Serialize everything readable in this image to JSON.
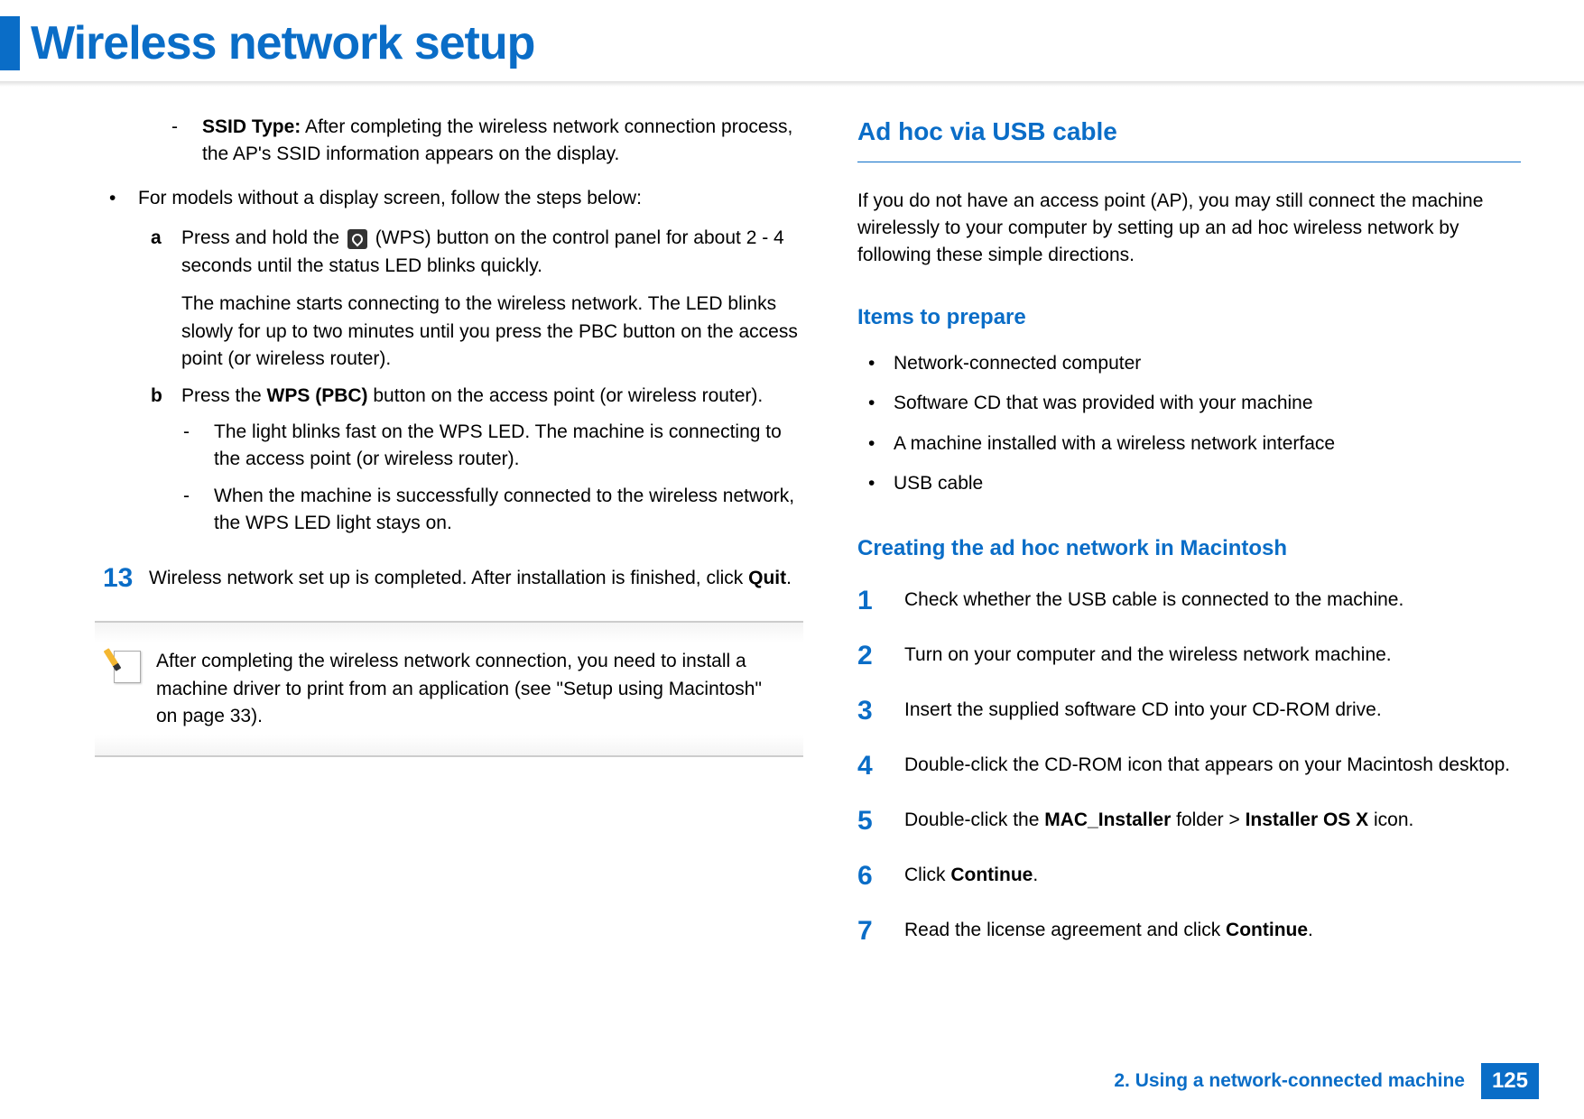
{
  "page_title": "Wireless network setup",
  "left": {
    "ssid_dash": {
      "label": "SSID Type:",
      "text": " After completing the wireless network connection process, the AP's SSID information appears on the display."
    },
    "no_display_bullet": "For models without a display screen, follow the steps below:",
    "step_a_pre": "Press and hold the ",
    "step_a_post": " (WPS) button on the control panel for about 2 - 4 seconds until the status LED blinks quickly.",
    "step_a_para2": "The machine starts connecting to the wireless network. The LED blinks slowly for up to two minutes until you press the PBC button on the access point (or wireless router).",
    "step_b_pre": "Press the ",
    "step_b_bold": "WPS (PBC)",
    "step_b_post": " button on the access point (or wireless router).",
    "b_dash1": "The light blinks fast on the WPS LED. The machine is connecting to the access point (or wireless router).",
    "b_dash2": "When the machine is successfully connected to the wireless network, the WPS LED light stays on.",
    "step13_num": "13",
    "step13_pre": "Wireless network set up is completed. After installation is finished, click ",
    "step13_bold": "Quit",
    "step13_post": ".",
    "note": "After completing the wireless network connection, you need to install a machine driver to print from an application (see \"Setup using Macintosh\" on page 33)."
  },
  "right": {
    "heading_adhoc": "Ad hoc via USB cable",
    "adhoc_intro": "If you do not have an access point (AP), you may still connect the machine wirelessly to your computer by setting up an ad hoc wireless network by following these simple directions.",
    "heading_items": "Items to prepare",
    "items": [
      "Network-connected computer",
      "Software CD that was provided with your machine",
      "A machine installed with a wireless network interface",
      "USB cable"
    ],
    "heading_create": "Creating the ad hoc network in Macintosh",
    "steps": [
      {
        "n": "1",
        "t": "Check whether the USB cable is connected to the machine."
      },
      {
        "n": "2",
        "t": "Turn on your computer and the wireless network machine."
      },
      {
        "n": "3",
        "t": "Insert the supplied software CD into your CD-ROM drive."
      },
      {
        "n": "4",
        "t": "Double-click the CD-ROM icon that appears on your Macintosh desktop."
      },
      {
        "n": "5",
        "pre": "Double-click the ",
        "b1": "MAC_Installer",
        "mid": " folder > ",
        "b2": "Installer OS X",
        "post": " icon."
      },
      {
        "n": "6",
        "pre": "Click ",
        "b1": "Continue",
        "post": "."
      },
      {
        "n": "7",
        "pre": "Read the license agreement and click ",
        "b1": "Continue",
        "post": "."
      }
    ]
  },
  "footer": {
    "chapter": "2. Using a network-connected machine",
    "page": "125"
  }
}
